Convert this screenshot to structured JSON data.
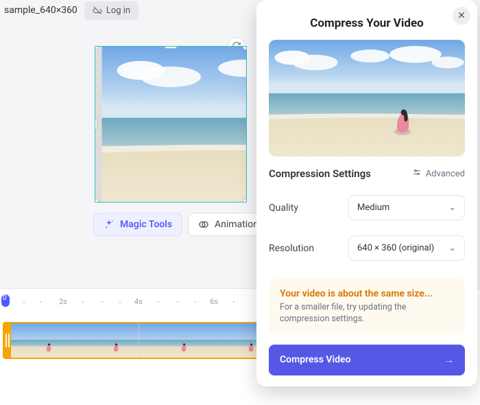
{
  "topbar": {
    "filename": "sample_640×360",
    "login_label": "Log in"
  },
  "tools": {
    "magic_label": "Magic Tools",
    "animation_label": "Animation"
  },
  "timeline": {
    "playhead_label": "0",
    "tick_labels": [
      "2s",
      "4s",
      "6s"
    ]
  },
  "panel": {
    "title": "Compress Your Video",
    "settings_heading": "Compression Settings",
    "advanced_label": "Advanced",
    "quality": {
      "label": "Quality",
      "value": "Medium"
    },
    "resolution": {
      "label": "Resolution",
      "value": "640 × 360 (original)"
    },
    "info": {
      "title": "Your video is about the same size...",
      "subtitle": "For a smaller file, try updating the compression settings."
    },
    "cta_label": "Compress Video"
  }
}
